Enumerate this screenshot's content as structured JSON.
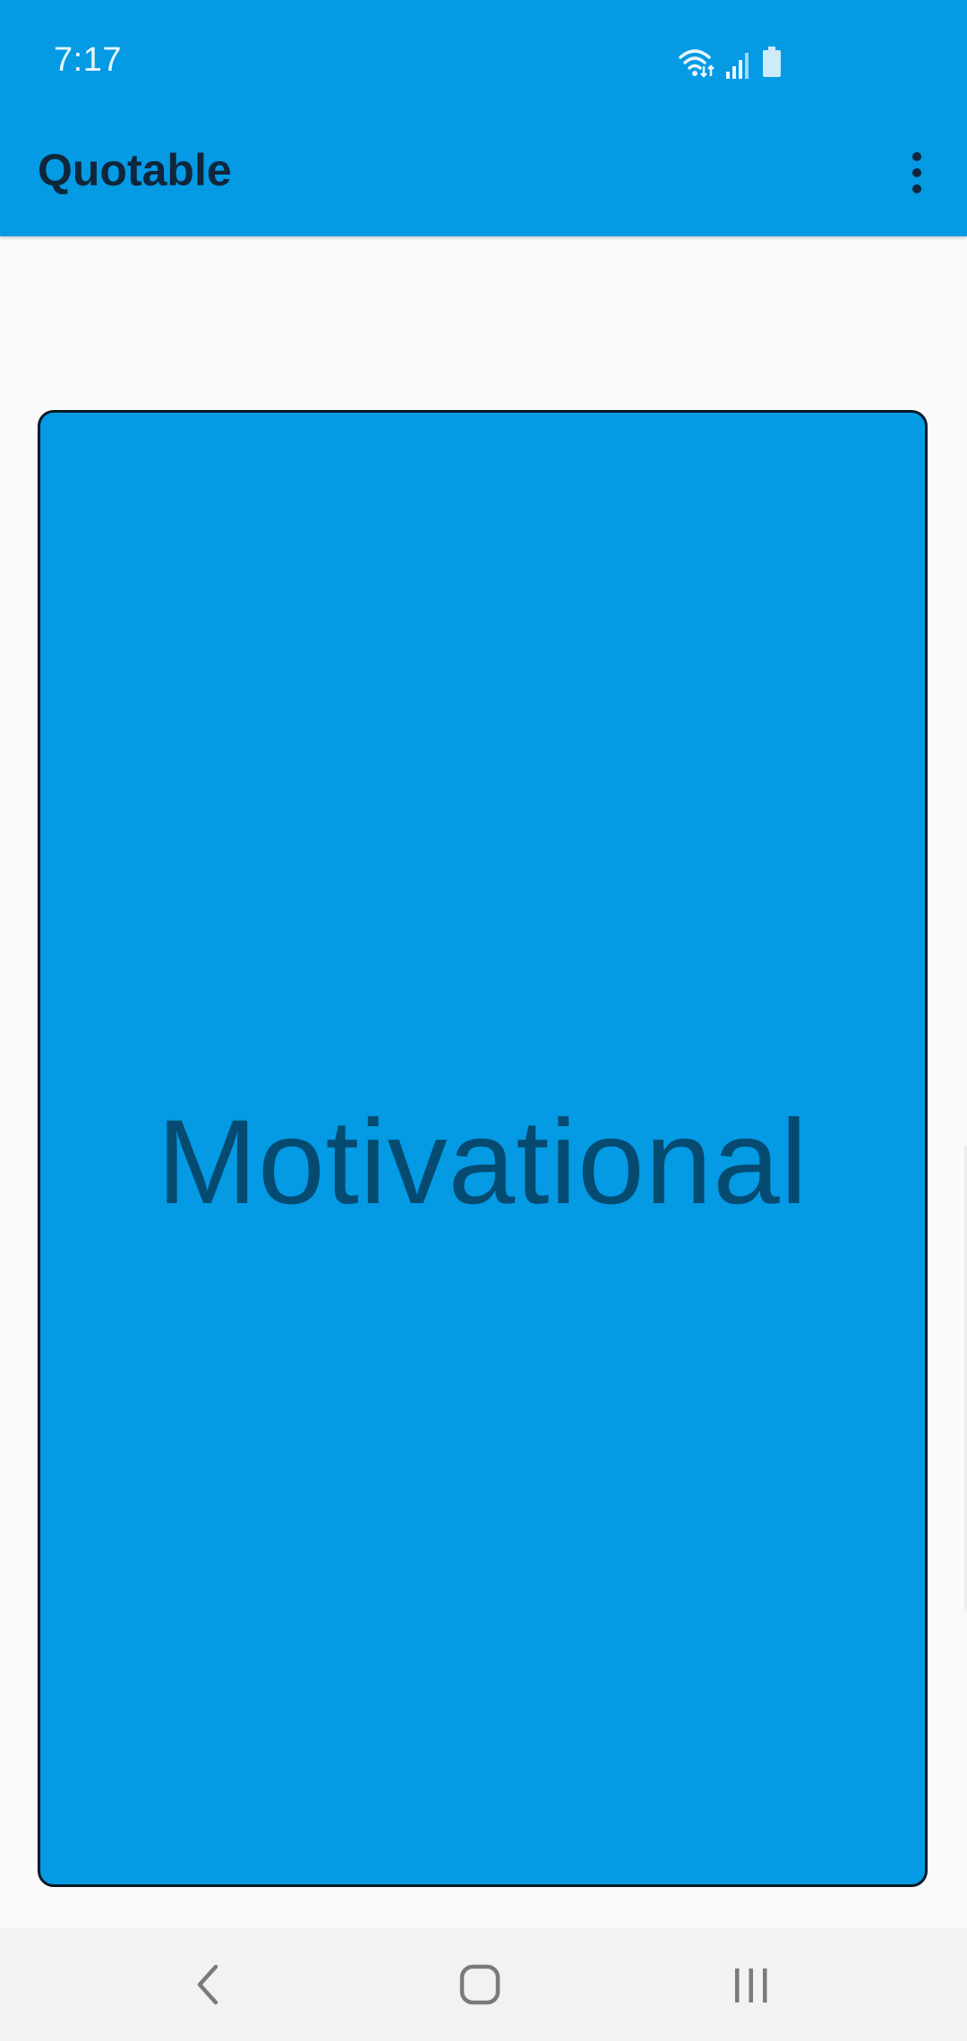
{
  "status_bar": {
    "time": "7:17",
    "icons": [
      "wifi-icon",
      "signal-icon",
      "battery-icon"
    ]
  },
  "app_bar": {
    "title": "Quotable",
    "menu_icon": "more-vert-icon"
  },
  "card": {
    "label": "Motivational"
  },
  "nav_bar": {
    "buttons": [
      "back-icon",
      "home-icon",
      "recents-icon"
    ]
  },
  "colors": {
    "primary": "#049ae4",
    "title_text": "#10263a",
    "card_text": "#054a70",
    "background": "#fafafa",
    "nav_background": "#f2f2f2"
  }
}
